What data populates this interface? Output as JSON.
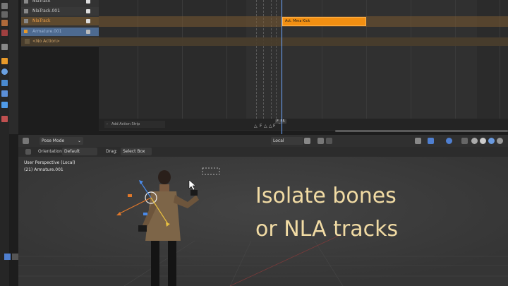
{
  "nla": {
    "tracks": [
      {
        "name": "NlaTrack",
        "color": "#cfcfcf"
      },
      {
        "name": "NlaTrack.001",
        "color": "#cfcfcf"
      },
      {
        "name": "NlaTrack",
        "color": "#f2a14a"
      },
      {
        "name": "Armature.001",
        "color": "#9fb6d6"
      }
    ],
    "no_action": "<No Action>",
    "strip_label": "Act. Mma Kick",
    "add_strip": "Add Action Strip",
    "frame": "F_55",
    "markers": [
      "F",
      "F"
    ]
  },
  "viewport": {
    "mode": "Pose Mode",
    "transform_space": "Local",
    "orientation_label": "Orientation:",
    "orientation_value": "Default",
    "drag_label": "Drag:",
    "drag_value": "Select Box",
    "perspective": "User Perspective (Local)",
    "object": "(21) Armature.001"
  },
  "overlay": {
    "line1": "Isolate bones",
    "line2": "or NLA tracks"
  },
  "colors": {
    "strip": "#f28f12",
    "playhead": "#6ea7ff",
    "overlay_text": "#f1dba4"
  }
}
